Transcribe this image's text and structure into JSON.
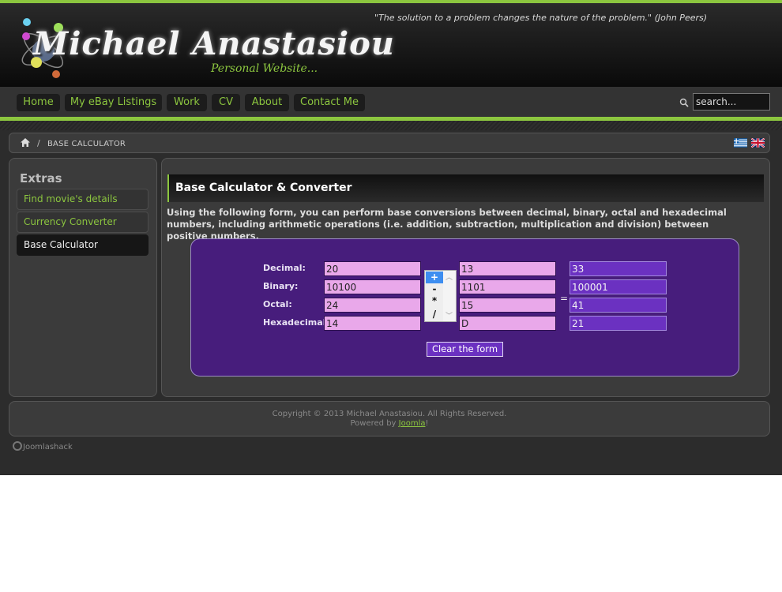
{
  "header": {
    "site_title": "Michael Anastasiou",
    "site_subtitle": "Personal Website...",
    "quote": "\"The solution to a problem changes the nature of the problem.\" (John Peers)"
  },
  "nav": {
    "items": [
      {
        "label": "Home"
      },
      {
        "label": "My eBay Listings"
      },
      {
        "label": "Work"
      },
      {
        "label": "CV"
      },
      {
        "label": "About"
      },
      {
        "label": "Contact Me"
      }
    ],
    "search_placeholder": "search..."
  },
  "breadcrumb": {
    "separator": "/",
    "current": "BASE CALCULATOR",
    "languages": [
      "Greek",
      "English"
    ]
  },
  "sidebar": {
    "title": "Extras",
    "items": [
      {
        "label": "Find movie's details",
        "active": false
      },
      {
        "label": "Currency Converter",
        "active": false
      },
      {
        "label": "Base Calculator",
        "active": true
      }
    ]
  },
  "main": {
    "title": "Base Calculator & Converter",
    "intro": "Using the following form, you can perform base conversions between decimal, binary, octal and hexadecimal numbers, including arithmetic operations (i.e. addition, subtraction, multiplication and division) between positive numbers."
  },
  "calculator": {
    "rows": [
      {
        "label": "Decimal:",
        "operand1": "20",
        "operand2": "13",
        "result": "33"
      },
      {
        "label": "Binary:",
        "operand1": "10100",
        "operand2": "1101",
        "result": "100001"
      },
      {
        "label": "Octal:",
        "operand1": "24",
        "operand2": "15",
        "result": "41"
      },
      {
        "label": "Hexadecimal:",
        "operand1": "14",
        "operand2": "D",
        "result": "21"
      }
    ],
    "operators": [
      "+",
      "-",
      "*",
      "/"
    ],
    "selected_operator": "+",
    "equals": "=",
    "clear_label": "Clear the form",
    "colors": {
      "panel": "#471d7c",
      "input": "#e9a8ea",
      "result": "#6b31c1"
    }
  },
  "footer": {
    "copyright": "Copyright © 2013 Michael Anastasiou. All Rights Reserved.",
    "powered_prefix": "Powered by ",
    "powered_link": "Joomla",
    "powered_suffix": "!",
    "badge": "Joomlashack"
  },
  "colors": {
    "accent": "#8cc63f",
    "background": "#2c2c2c"
  }
}
